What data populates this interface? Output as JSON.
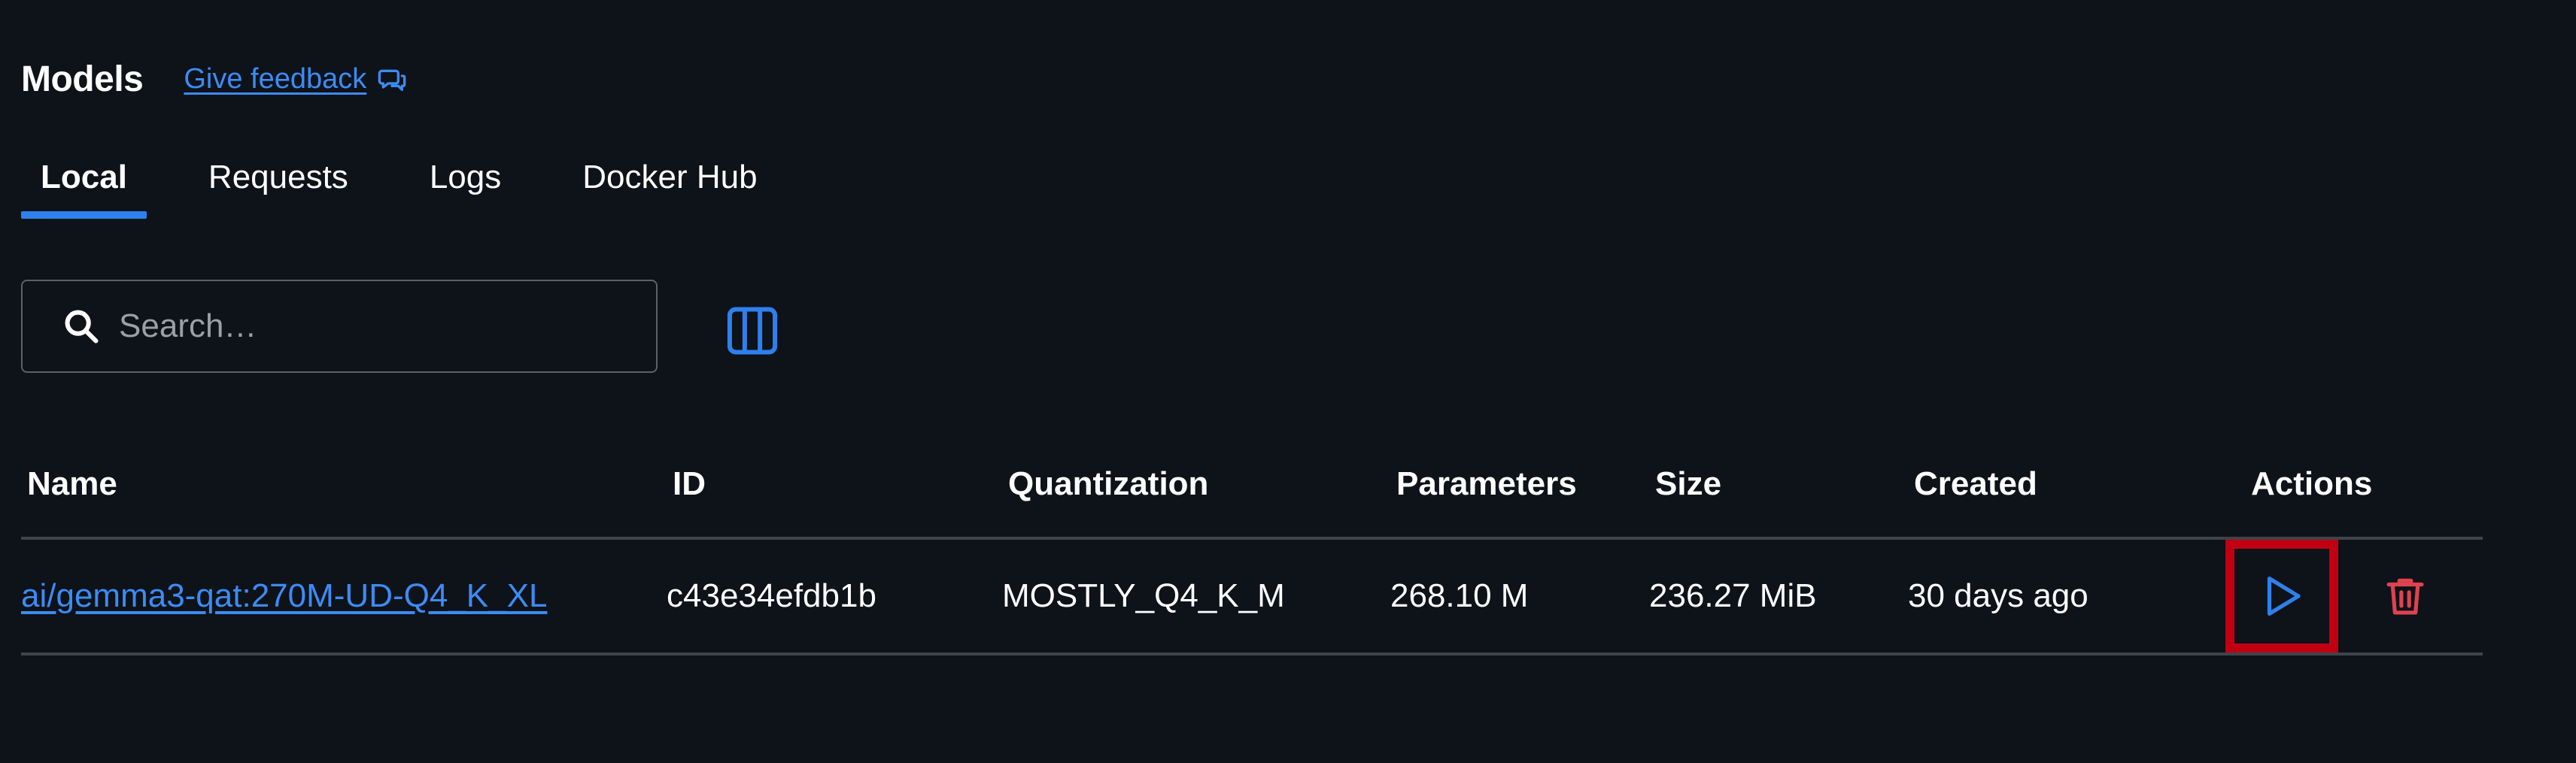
{
  "header": {
    "title": "Models",
    "feedback_label": "Give feedback",
    "feedback_icon": "chat-feedback-icon"
  },
  "tabs": [
    {
      "label": "Local",
      "active": true
    },
    {
      "label": "Requests",
      "active": false
    },
    {
      "label": "Logs",
      "active": false
    },
    {
      "label": "Docker Hub",
      "active": false
    }
  ],
  "search": {
    "placeholder": "Search…",
    "value": "",
    "icon": "search-icon"
  },
  "columns_button": {
    "icon": "columns-icon"
  },
  "table": {
    "columns": [
      "Name",
      "ID",
      "Quantization",
      "Parameters",
      "Size",
      "Created",
      "Actions"
    ],
    "rows": [
      {
        "name": "ai/gemma3-qat:270M-UD-Q4_K_XL",
        "id": "c43e34efdb1b",
        "quantization": "MOSTLY_Q4_K_M",
        "parameters": "268.10 M",
        "size": "236.27 MiB",
        "created": "30 days ago",
        "actions": [
          "play-icon",
          "trash-icon"
        ]
      }
    ]
  },
  "colors": {
    "background": "#0e1219",
    "accent": "#2f80ed",
    "link": "#3b8cf5",
    "danger": "#e0424f",
    "highlight": "#c00012"
  }
}
